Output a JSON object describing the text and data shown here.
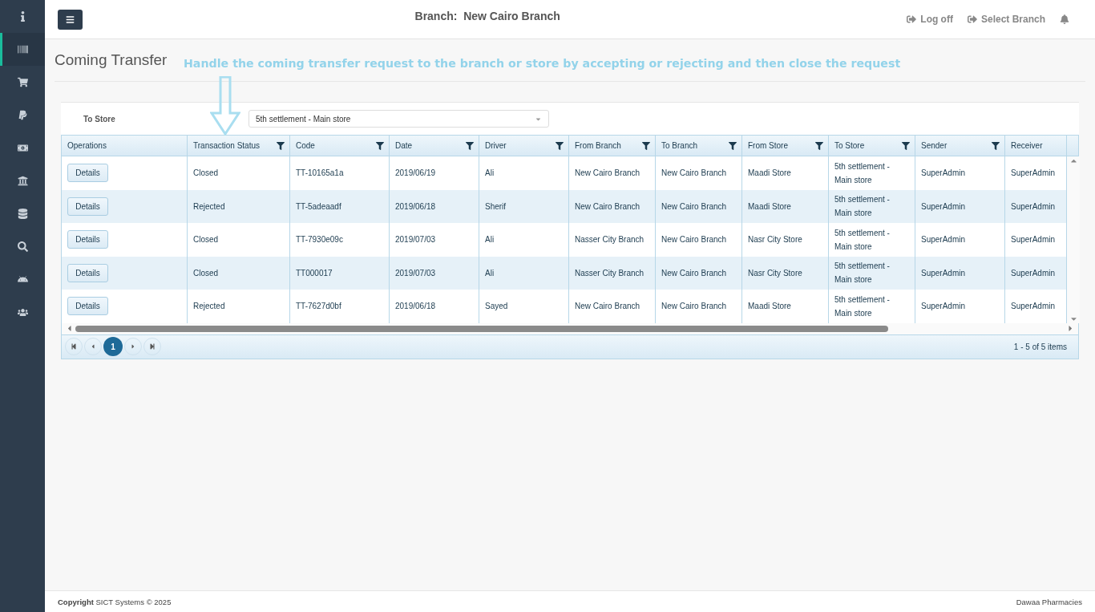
{
  "sidebar": {
    "items": [
      {
        "selected": false
      },
      {
        "selected": true
      },
      {
        "selected": false
      },
      {
        "selected": false
      },
      {
        "selected": false
      },
      {
        "selected": false
      },
      {
        "selected": false
      },
      {
        "selected": false
      },
      {
        "selected": false
      },
      {
        "selected": false
      }
    ]
  },
  "header": {
    "branch_label": "Branch:",
    "branch_name": "New Cairo Branch",
    "links": [
      "Log off",
      "Select Branch"
    ]
  },
  "page": {
    "title": "Coming Transfer"
  },
  "annotation": {
    "text": "Handle the coming transfer request to the branch or store by accepting or rejecting and then close the request"
  },
  "filter": {
    "label": "To Store",
    "value": "5th settlement - Main store"
  },
  "table": {
    "columns": [
      {
        "label": "Operations",
        "kind": "button",
        "filterable": false
      },
      {
        "label": "Transaction Status",
        "kind": "text",
        "filterable": true
      },
      {
        "label": "Code",
        "kind": "text",
        "filterable": true
      },
      {
        "label": "Date",
        "kind": "text",
        "filterable": true
      },
      {
        "label": "Driver",
        "kind": "text",
        "filterable": true
      },
      {
        "label": "From Branch",
        "kind": "text",
        "filterable": true
      },
      {
        "label": "To Branch",
        "kind": "text",
        "filterable": true
      },
      {
        "label": "From Store",
        "kind": "text",
        "filterable": true
      },
      {
        "label": "To Store",
        "kind": "text",
        "filterable": true
      },
      {
        "label": "Sender",
        "kind": "text",
        "filterable": true
      },
      {
        "label": "Receiver",
        "kind": "text",
        "filterable": false
      }
    ],
    "rows": [
      {
        "cells": [
          "Details",
          "Closed",
          "TT-10165a1a",
          "2019/06/19",
          "Ali",
          "New Cairo Branch",
          "New Cairo Branch",
          "Maadi Store",
          "5th settlement - Main store",
          "SuperAdmin",
          "SuperAdmin"
        ]
      },
      {
        "cells": [
          "Details",
          "Rejected",
          "TT-5adeaadf",
          "2019/06/18",
          "Sherif",
          "New Cairo Branch",
          "New Cairo Branch",
          "Maadi Store",
          "5th settlement - Main store",
          "SuperAdmin",
          "SuperAdmin"
        ]
      },
      {
        "cells": [
          "Details",
          "Closed",
          "TT-7930e09c",
          "2019/07/03",
          "Ali",
          "Nasser City Branch",
          "New Cairo Branch",
          "Nasr City Store",
          "5th settlement - Main store",
          "SuperAdmin",
          "SuperAdmin"
        ]
      },
      {
        "cells": [
          "Details",
          "Closed",
          "TT000017",
          "2019/07/03",
          "Ali",
          "Nasser City Branch",
          "New Cairo Branch",
          "Nasr City Store",
          "5th settlement - Main store",
          "SuperAdmin",
          "SuperAdmin"
        ]
      },
      {
        "cells": [
          "Details",
          "Rejected",
          "TT-7627d0bf",
          "2019/06/18",
          "Sayed",
          "New Cairo Branch",
          "New Cairo Branch",
          "Maadi Store",
          "5th settlement - Main store",
          "SuperAdmin",
          "SuperAdmin"
        ]
      }
    ]
  },
  "pager": {
    "pages": [
      {
        "label": "1",
        "selected": true
      }
    ],
    "summary": "1 - 5 of 5 items"
  },
  "footer": {
    "copyright": "**Copyright** SICT Systems © 2025",
    "brand": "Dawaa Pharmacies"
  }
}
